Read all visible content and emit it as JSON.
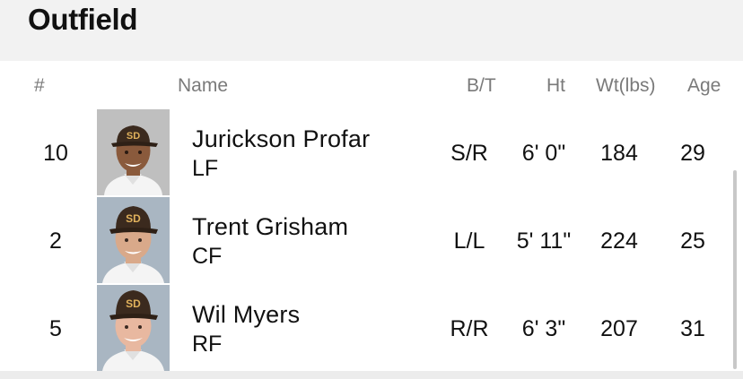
{
  "section": {
    "title": "Outfield"
  },
  "columns": {
    "number": "#",
    "name": "Name",
    "bats_throws": "B/T",
    "height": "Ht",
    "weight": "Wt(lbs)",
    "age": "Age"
  },
  "players": [
    {
      "number": "10",
      "name": "Jurickson Profar",
      "position": "LF",
      "bats_throws": "S/R",
      "height": "6' 0\"",
      "weight": "184",
      "age": "29",
      "photo_bg": "#bfbfbf",
      "skin": "#8a5a3c"
    },
    {
      "number": "2",
      "name": "Trent Grisham",
      "position": "CF",
      "bats_throws": "L/L",
      "height": "5' 11\"",
      "weight": "224",
      "age": "25",
      "photo_bg": "#a9b6c2",
      "skin": "#d9a98a"
    },
    {
      "number": "5",
      "name": "Wil Myers",
      "position": "RF",
      "bats_throws": "R/R",
      "height": "6' 3\"",
      "weight": "207",
      "age": "31",
      "photo_bg": "#a9b6c2",
      "skin": "#e8b8a0"
    }
  ],
  "colors": {
    "cap": "#3b2a1e",
    "cap_logo": "#e0b15c",
    "jersey": "#f4f4f4"
  },
  "icons": {
    "player_photo": "player-headshot-icon"
  }
}
